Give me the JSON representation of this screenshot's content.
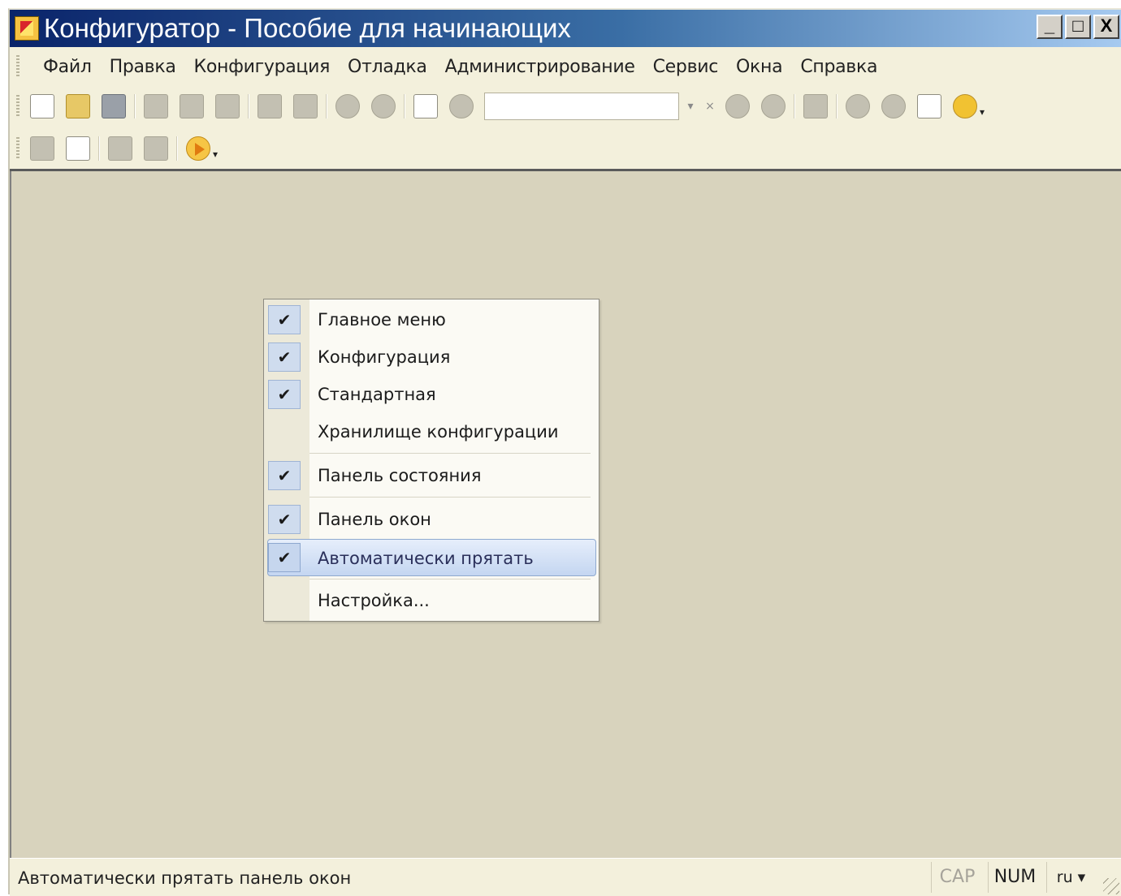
{
  "window": {
    "title": "Конфигуратор - Пособие для начинающих",
    "minimize": "_",
    "maximize": "□",
    "close": "X"
  },
  "menu": [
    {
      "label": "Файл"
    },
    {
      "label": "Правка"
    },
    {
      "label": "Конфигурация"
    },
    {
      "label": "Отладка"
    },
    {
      "label": "Администрирование"
    },
    {
      "label": "Сервис"
    },
    {
      "label": "Окна"
    },
    {
      "label": "Справка"
    }
  ],
  "toolbar": {
    "search_clear": "×",
    "search_dropdown": "▾",
    "dropdown_arrow": "▾"
  },
  "context_menu": {
    "items": [
      {
        "label": "Главное меню",
        "checked": true,
        "check_mark": "✔"
      },
      {
        "label": "Конфигурация",
        "checked": true,
        "check_mark": "✔"
      },
      {
        "label": "Стандартная",
        "checked": true,
        "check_mark": "✔"
      },
      {
        "label": "Хранилище конфигурации",
        "checked": false
      },
      {
        "label": "Панель состояния",
        "checked": true,
        "check_mark": "✔"
      },
      {
        "label": "Панель окон",
        "checked": true,
        "check_mark": "✔"
      },
      {
        "label": "Автоматически прятать",
        "checked": true,
        "check_mark": "✔",
        "highlighted": true
      },
      {
        "label": "Настройка...",
        "checked": false
      }
    ]
  },
  "statusbar": {
    "text": "Автоматически прятать панель окон",
    "cap": "CAP",
    "num": "NUM",
    "lang": "ru ▾"
  },
  "colors": {
    "title_gradient_start": "#0a246a",
    "workspace": "#d8d3bd",
    "menu_highlight": "#c4d6f1"
  }
}
